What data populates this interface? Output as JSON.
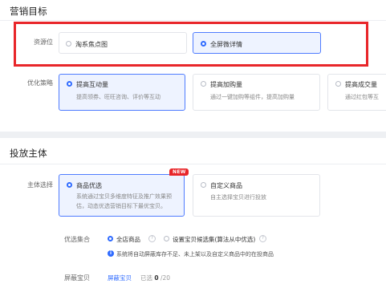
{
  "marketing_goal": {
    "title": "营销目标",
    "resource": {
      "label": "资源位",
      "options": [
        {
          "label": "淘系焦点图",
          "selected": false
        },
        {
          "label": "全屏微详情",
          "selected": true
        }
      ]
    },
    "strategy": {
      "label": "优化策略",
      "options": [
        {
          "title": "提高互动量",
          "desc": "提高领券、旺旺咨询、评价等互动",
          "selected": true
        },
        {
          "title": "提高加购量",
          "desc": "通过一键加购等组件，提高加购量",
          "selected": false
        },
        {
          "title": "提高成交量",
          "desc": "通过红包等互",
          "selected": false
        }
      ]
    }
  },
  "subject": {
    "title": "投放主体",
    "choice": {
      "label": "主体选择",
      "options": [
        {
          "title": "商品优选",
          "badge": "NEW",
          "desc": "系统通过宝贝多维度特征及推广效果预估，动态优选营销目标下最优宝贝。",
          "selected": true
        },
        {
          "title": "自定义商品",
          "desc": "自主选择宝贝进行投放",
          "selected": false
        }
      ]
    },
    "pool": {
      "label": "优选集合",
      "options": [
        {
          "label": "全店商品",
          "selected": true
        },
        {
          "label": "设置宝贝候选集(算法从中优选)",
          "selected": false
        }
      ],
      "hint": "系统将自动屏蔽库存不足、未上架以及自定义商品中的在投商品"
    },
    "blocked": {
      "label": "屏蔽宝贝",
      "link": "屏蔽宝贝",
      "count_prefix": "已选",
      "count_value": "0",
      "count_total": "/20"
    }
  },
  "colors": {
    "accent": "#2f6bff",
    "highlight_box": "#e8262a",
    "selected_bg": "#eef3ff"
  }
}
